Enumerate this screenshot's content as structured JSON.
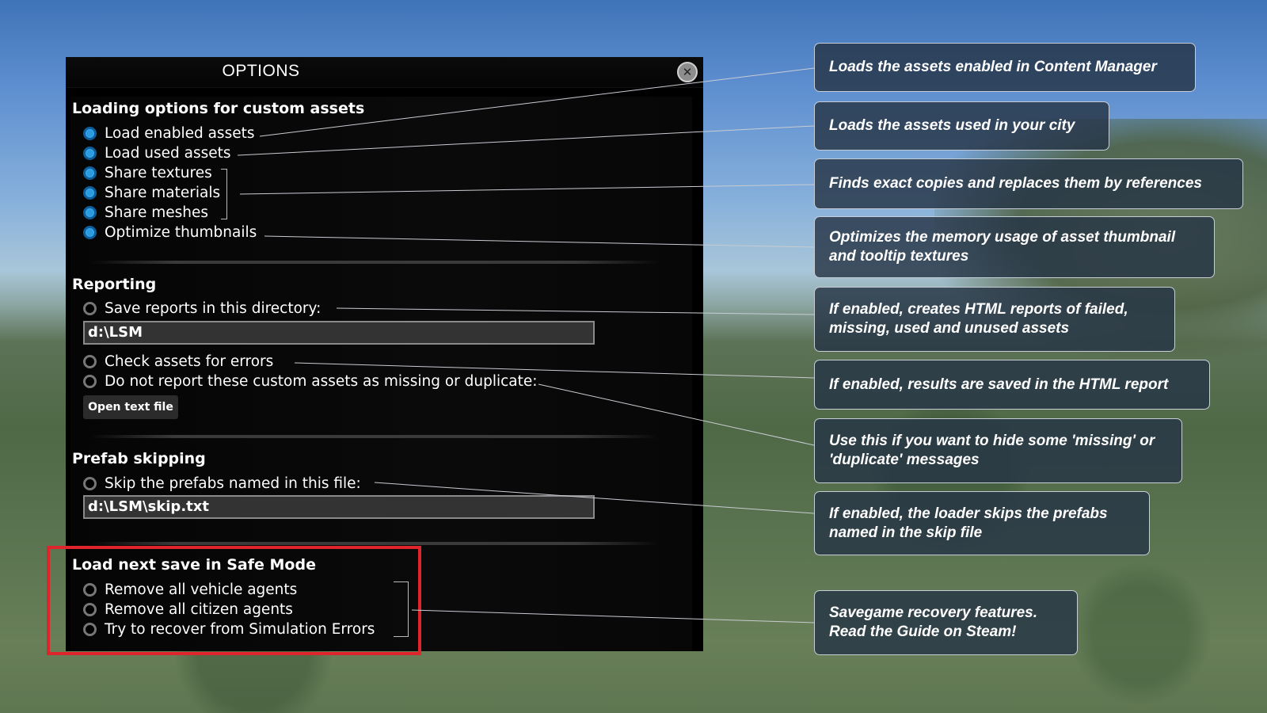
{
  "dialog": {
    "title": "OPTIONS",
    "close_icon": "close-icon",
    "sections": {
      "loading": {
        "title": "Loading options for custom assets",
        "options": [
          {
            "label": "Load enabled assets",
            "checked": true
          },
          {
            "label": "Load used assets",
            "checked": true
          },
          {
            "label": "Share textures",
            "checked": true
          },
          {
            "label": "Share materials",
            "checked": true
          },
          {
            "label": "Share meshes",
            "checked": true
          },
          {
            "label": "Optimize thumbnails",
            "checked": true
          }
        ]
      },
      "reporting": {
        "title": "Reporting",
        "save_reports_label": "Save reports in this directory:",
        "save_reports_checked": false,
        "directory_value": "d:\\LSM",
        "check_errors_label": "Check assets for errors",
        "check_errors_checked": false,
        "do_not_report_label": "Do not report these custom assets as missing or duplicate:",
        "do_not_report_checked": false,
        "open_text_file_button": "Open text file"
      },
      "prefab": {
        "title": "Prefab skipping",
        "skip_label": "Skip the prefabs named in this file:",
        "skip_checked": false,
        "skip_file_value": "d:\\LSM\\skip.txt"
      },
      "safe_mode": {
        "title": "Load next save in Safe Mode",
        "options": [
          {
            "label": "Remove all vehicle agents",
            "checked": false
          },
          {
            "label": "Remove all citizen agents",
            "checked": false
          },
          {
            "label": "Try to recover from Simulation Errors",
            "checked": false
          }
        ]
      }
    }
  },
  "callouts": [
    "Loads the assets  enabled in Content Manager",
    "Loads the assets  used in your city",
    "Finds exact copies and replaces them by references",
    "Optimizes the memory usage of asset thumbnail and tooltip textures",
    "If enabled, creates HTML reports of failed, missing, used and unused assets",
    "If enabled, results are saved in the HTML report",
    "Use this if you want to hide some  'missing' or 'duplicate' messages",
    "If enabled, the loader skips the prefabs named in the skip file",
    "Savegame recovery features. Read the Guide on Steam!"
  ],
  "colors": {
    "radio_on": "#2a9be0",
    "highlight": "#e0242c",
    "callout_bg": "#26344682"
  }
}
